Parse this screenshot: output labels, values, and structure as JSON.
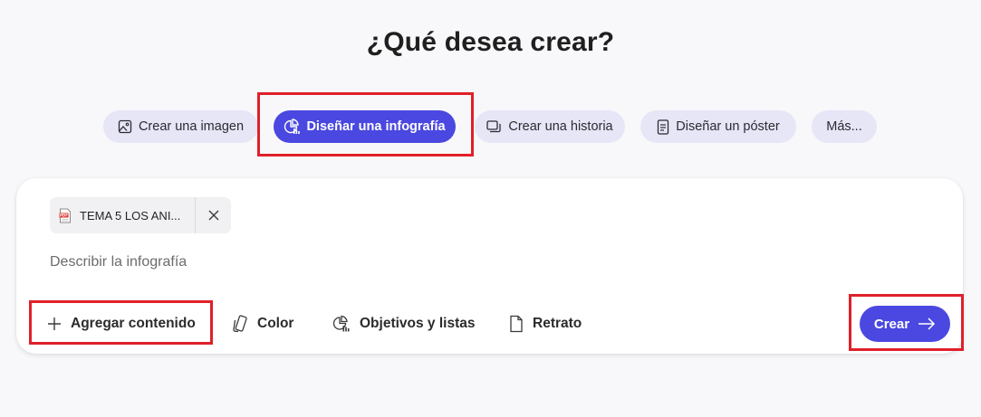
{
  "heading": "¿Qué desea crear?",
  "options": {
    "crear_imagen": "Crear una imagen",
    "disenar_infografia": "Diseñar una infografía",
    "crear_historia": "Crear una historia",
    "disenar_poster": "Diseñar un póster",
    "mas": "Más..."
  },
  "selected_option": "Diseñar una infografía",
  "attachment": {
    "file_name": "TEMA 5 LOS ANI...",
    "file_type": "pdf"
  },
  "prompt": {
    "placeholder": "Describir la infografía"
  },
  "toolbar": {
    "agregar_contenido": "Agregar contenido",
    "color": "Color",
    "objetivos": "Objetivos y listas",
    "retrato": "Retrato"
  },
  "submit": {
    "label": "Crear"
  },
  "colors": {
    "accent": "#4a48e0",
    "pill_background": "#e6e6f7",
    "highlight": "#e0202a",
    "page_background": "#f8f8fa"
  }
}
